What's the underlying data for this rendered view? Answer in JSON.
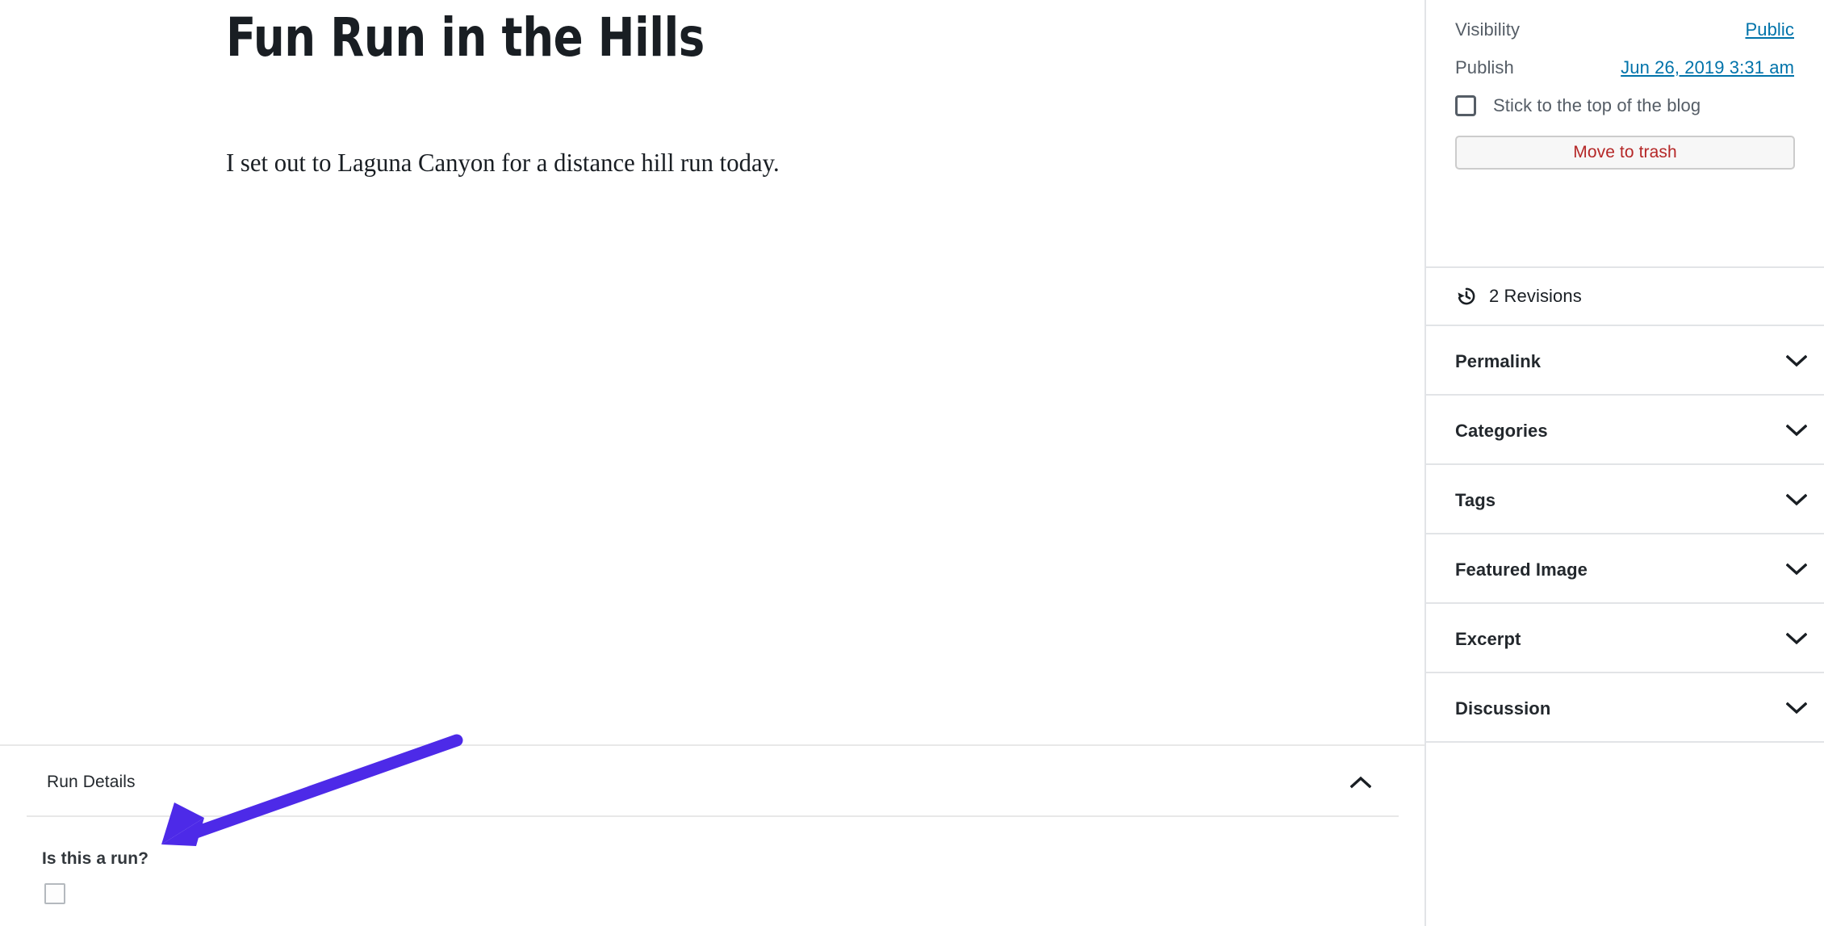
{
  "editor": {
    "title": "Fun Run in the Hills",
    "paragraph": "I set out to Laguna Canyon for a distance hill run today.",
    "metabox": {
      "title": "Run Details",
      "toggle_icon": "chevron-up-icon",
      "field_label": "Is this a run?",
      "field_checked": false
    }
  },
  "sidebar": {
    "status": {
      "visibility_label": "Visibility",
      "visibility_value": "Public",
      "publish_label": "Publish",
      "publish_value": "Jun 26, 2019 3:31 am",
      "sticky_label": "Stick to the top of the blog",
      "sticky_checked": false,
      "trash_label": "Move to trash"
    },
    "revisions": {
      "icon": "history-clock-icon",
      "label": "2 Revisions"
    },
    "panels": [
      {
        "label": "Permalink",
        "icon": "chevron-down-icon"
      },
      {
        "label": "Categories",
        "icon": "chevron-down-icon"
      },
      {
        "label": "Tags",
        "icon": "chevron-down-icon"
      },
      {
        "label": "Featured Image",
        "icon": "chevron-down-icon"
      },
      {
        "label": "Excerpt",
        "icon": "chevron-down-icon"
      },
      {
        "label": "Discussion",
        "icon": "chevron-down-icon"
      }
    ]
  },
  "annotation": {
    "type": "arrow",
    "color": "#4d2ae8",
    "points_to": "Is this a run?"
  },
  "colors": {
    "link": "#0073aa",
    "trash_text": "#b52727",
    "border": "#e2e4e7",
    "text": "#191e23",
    "muted_text": "#555d66",
    "arrow": "#4d2ae8"
  }
}
